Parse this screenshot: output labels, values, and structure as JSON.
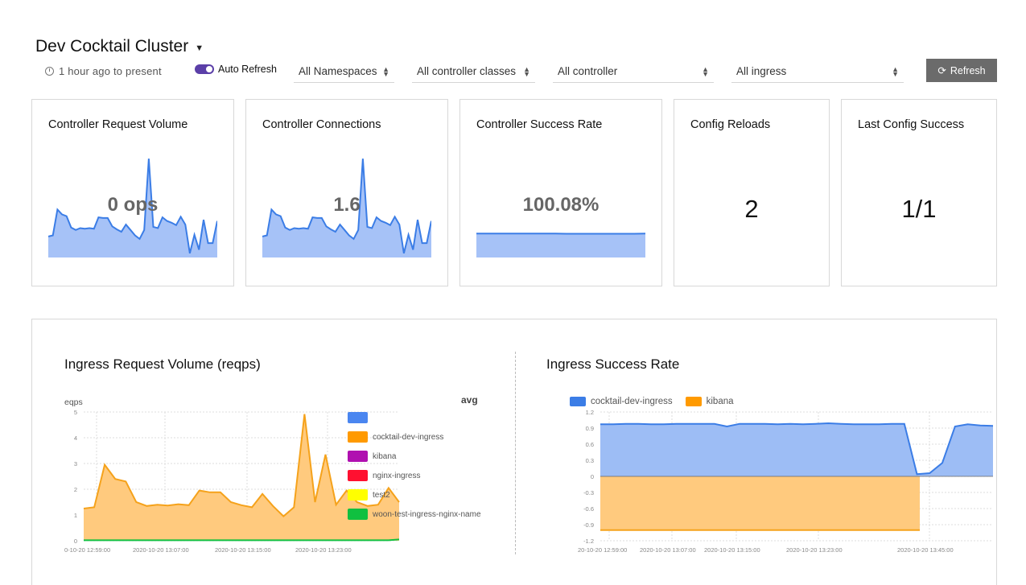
{
  "header": {
    "title": "Dev Cocktail Cluster",
    "time_range": "1 hour ago to present",
    "auto_refresh_label": "Auto Refresh",
    "filters": {
      "namespace": "All Namespaces",
      "controller_class": "All controller classes",
      "controller": "All controller",
      "ingress": "All ingress"
    },
    "refresh_label": "Refresh"
  },
  "cards": {
    "request_volume": {
      "title": "Controller Request Volume",
      "value": "0 ops",
      "chart_data": {
        "type": "area",
        "values": [
          0.35,
          0.37,
          0.8,
          0.72,
          0.69,
          0.5,
          0.46,
          0.49,
          0.48,
          0.49,
          0.48,
          0.67,
          0.66,
          0.66,
          0.52,
          0.47,
          0.43,
          0.55,
          0.46,
          0.37,
          0.31,
          0.46,
          1.65,
          0.51,
          0.49,
          0.67,
          0.61,
          0.58,
          0.54,
          0.68,
          0.55,
          0.07,
          0.38,
          0.13,
          0.63,
          0.24,
          0.24,
          0.61
        ],
        "color": "#3b7de6",
        "fill": "#a6c2f7"
      }
    },
    "connections": {
      "title": "Controller Connections",
      "value": "1.6",
      "chart_data": {
        "type": "area",
        "values": [
          0.35,
          0.37,
          0.8,
          0.72,
          0.69,
          0.5,
          0.46,
          0.49,
          0.48,
          0.49,
          0.48,
          0.67,
          0.66,
          0.66,
          0.52,
          0.47,
          0.43,
          0.55,
          0.46,
          0.37,
          0.31,
          0.46,
          1.65,
          0.51,
          0.49,
          0.67,
          0.61,
          0.58,
          0.54,
          0.68,
          0.55,
          0.07,
          0.38,
          0.13,
          0.63,
          0.24,
          0.24,
          0.61
        ],
        "color": "#3b7de6",
        "fill": "#a6c2f7"
      }
    },
    "success_rate": {
      "title": "Controller Success Rate",
      "value": "100.08%",
      "chart_data": {
        "type": "area",
        "values": [
          1.0,
          1.0,
          1.0,
          1.0,
          1.0,
          1.0,
          1.0,
          1.0,
          0.99,
          0.99,
          0.99,
          0.99,
          0.99,
          0.99,
          0.99,
          1.0
        ],
        "color": "#3b7de6",
        "fill": "#a6c2f7"
      }
    },
    "config_reloads": {
      "title": "Config Reloads",
      "value": "2"
    },
    "last_config_success": {
      "title": "Last Config Success",
      "value": "1/1"
    }
  },
  "ingress_request_volume": {
    "title": "Ingress Request Volume (reqps)",
    "avg_label": "avg",
    "legend": [
      {
        "name": "",
        "color": "#4a86f0"
      },
      {
        "name": "cocktail-dev-ingress",
        "color": "#ff9a00"
      },
      {
        "name": "kibana",
        "color": "#b010b0"
      },
      {
        "name": "nginx-ingress",
        "color": "#ff1030"
      },
      {
        "name": "test2",
        "color": "#ffff00"
      },
      {
        "name": "woon-test-ingress-nginx-name",
        "color": "#10c040"
      }
    ],
    "chart_data": {
      "type": "area",
      "ylabel": "eqps",
      "ylim": [
        0,
        5
      ],
      "yticks": [
        "0",
        "1",
        "2",
        "3",
        "4",
        "5"
      ],
      "xticks": [
        "0-10-20 12:59:00",
        "2020-10-20 13:07:00",
        "2020-10-20 13:15:00",
        "2020-10-20 13:23:00"
      ],
      "series": [
        {
          "name": "cocktail-dev-ingress",
          "color": "#f5a21b",
          "fill": "#ffca7e",
          "values": [
            1.25,
            1.3,
            2.95,
            2.4,
            2.3,
            1.5,
            1.35,
            1.4,
            1.37,
            1.42,
            1.38,
            1.95,
            1.88,
            1.88,
            1.5,
            1.38,
            1.3,
            1.82,
            1.35,
            0.95,
            1.3,
            4.92,
            1.5,
            3.35,
            1.4,
            1.95,
            1.5,
            1.35,
            1.4,
            2.05,
            1.5
          ]
        },
        {
          "name": "woon-test-ingress-nginx-name",
          "color": "#10c040",
          "values": [
            0.02,
            0.02,
            0.02,
            0.02,
            0.02,
            0.02,
            0.02,
            0.02,
            0.02,
            0.02,
            0.02,
            0.02,
            0.02,
            0.02,
            0.02,
            0.02,
            0.02,
            0.02,
            0.02,
            0.02,
            0.02,
            0.02,
            0.02,
            0.02,
            0.02,
            0.02,
            0.02,
            0.02,
            0.02,
            0.02,
            0.05
          ]
        }
      ]
    }
  },
  "ingress_success_rate": {
    "title": "Ingress Success Rate",
    "legend": [
      {
        "name": "cocktail-dev-ingress",
        "color": "#3b7de6"
      },
      {
        "name": "kibana",
        "color": "#ff9a00"
      }
    ],
    "chart_data": {
      "type": "area",
      "ylim": [
        -1.2,
        1.2
      ],
      "yticks": [
        "1.2",
        "0.9",
        "0.6",
        "0.3",
        "0",
        "-0.3",
        "-0.6",
        "-0.9",
        "-1.2"
      ],
      "xticks": [
        "20-10-20 12:59:00",
        "2020-10-20 13:07:00",
        "2020-10-20 13:15:00",
        "2020-10-20 13:23:00",
        "2020-10-20 13:45:00"
      ],
      "series": [
        {
          "name": "cocktail-dev-ingress",
          "color": "#3b7de6",
          "fill": "#9dbdf5",
          "values": [
            0.97,
            0.97,
            0.98,
            0.98,
            0.97,
            0.97,
            0.98,
            0.98,
            0.98,
            0.98,
            0.93,
            0.98,
            0.98,
            0.98,
            0.97,
            0.98,
            0.97,
            0.98,
            0.99,
            0.98,
            0.97,
            0.97,
            0.97,
            0.98,
            0.98,
            0.04,
            0.06,
            0.25,
            0.93,
            0.97,
            0.95,
            0.94
          ]
        },
        {
          "name": "kibana",
          "color": "#f5a21b",
          "fill": "#ffca7e",
          "values": [
            -1.0,
            -1.0,
            -1.0,
            -1.0,
            -1.0,
            -1.0,
            -1.0,
            -1.0,
            -1.0,
            -1.0,
            -1.0,
            -1.0,
            -1.0,
            -1.0,
            -1.0,
            -1.0,
            -1.0,
            -1.0,
            -1.0,
            -1.0,
            -1.0,
            -1.0,
            -1.0,
            -1.0,
            -1.0
          ]
        }
      ]
    }
  }
}
